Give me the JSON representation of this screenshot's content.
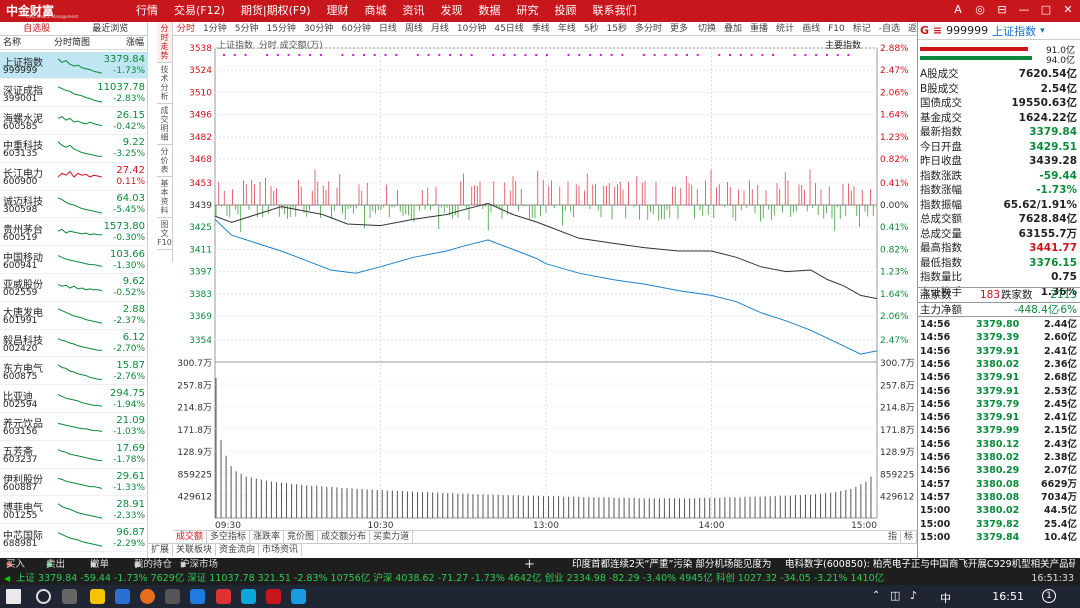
{
  "app": {
    "title": "中金财富",
    "subtitle": "CIRC Wealth Management"
  },
  "topmenu": [
    "行情",
    "交易(F12)",
    "期货|期权(F9)",
    "理财",
    "商城",
    "资讯",
    "发现",
    "数据",
    "研究",
    "投顾",
    "联系我们"
  ],
  "window_controls": [
    "A",
    "◎",
    "⊟",
    "—",
    "□",
    "✕"
  ],
  "left": {
    "tabs": [
      "自选股",
      "最近浏览"
    ],
    "headers": [
      "名称",
      "分时简图",
      "涨幅"
    ],
    "stocks": [
      {
        "name": "上证指数",
        "code": "999999",
        "price": "3379.84",
        "pct": "-1.73%",
        "dir": "down",
        "trend": [
          0.1,
          0.3,
          0.2,
          0.4,
          0.5,
          0.45,
          0.6,
          0.65,
          0.7,
          0.8,
          0.85,
          0.9
        ],
        "selected": true
      },
      {
        "name": "深证成指",
        "code": "399001",
        "price": "11037.78",
        "pct": "-2.83%",
        "dir": "down",
        "trend": [
          0.1,
          0.2,
          0.3,
          0.35,
          0.5,
          0.55,
          0.6,
          0.7,
          0.75,
          0.85,
          0.9,
          0.95
        ]
      },
      {
        "name": "海螺水泥",
        "code": "600585",
        "price": "26.15",
        "pct": "-0.42%",
        "dir": "down",
        "trend": [
          0.3,
          0.2,
          0.4,
          0.3,
          0.5,
          0.45,
          0.55,
          0.6,
          0.5,
          0.6,
          0.65,
          0.7
        ]
      },
      {
        "name": "中重科技",
        "code": "603135",
        "price": "9.22",
        "pct": "-3.25%",
        "dir": "down",
        "trend": [
          0.1,
          0.3,
          0.4,
          0.3,
          0.5,
          0.6,
          0.7,
          0.75,
          0.8,
          0.85,
          0.9,
          0.9
        ]
      },
      {
        "name": "长江电力",
        "code": "600900",
        "price": "27.42",
        "pct": "0.11%",
        "dir": "up",
        "trend": [
          0.5,
          0.3,
          0.4,
          0.2,
          0.5,
          0.3,
          0.4,
          0.35,
          0.5,
          0.4,
          0.45,
          0.5
        ]
      },
      {
        "name": "诚迈科技",
        "code": "300598",
        "price": "64.03",
        "pct": "-5.45%",
        "dir": "down",
        "trend": [
          0.1,
          0.2,
          0.35,
          0.45,
          0.5,
          0.6,
          0.7,
          0.75,
          0.8,
          0.85,
          0.9,
          0.95
        ]
      },
      {
        "name": "贵州茅台",
        "code": "600519",
        "price": "1573.80",
        "pct": "-0.30%",
        "dir": "down",
        "trend": [
          0.4,
          0.3,
          0.5,
          0.4,
          0.45,
          0.5,
          0.55,
          0.5,
          0.6,
          0.55,
          0.6,
          0.6
        ]
      },
      {
        "name": "中国移动",
        "code": "600941",
        "price": "103.66",
        "pct": "-1.30%",
        "dir": "down",
        "trend": [
          0.2,
          0.3,
          0.4,
          0.45,
          0.5,
          0.55,
          0.6,
          0.65,
          0.7,
          0.7,
          0.75,
          0.8
        ]
      },
      {
        "name": "亚威股份",
        "code": "002559",
        "price": "9.62",
        "pct": "-0.52%",
        "dir": "down",
        "trend": [
          0.3,
          0.4,
          0.35,
          0.5,
          0.4,
          0.55,
          0.5,
          0.6,
          0.55,
          0.6,
          0.6,
          0.65
        ]
      },
      {
        "name": "大唐发电",
        "code": "601991",
        "price": "2.88",
        "pct": "-2.37%",
        "dir": "down",
        "trend": [
          0.1,
          0.2,
          0.3,
          0.4,
          0.5,
          0.55,
          0.6,
          0.7,
          0.75,
          0.8,
          0.85,
          0.9
        ]
      },
      {
        "name": "毅昌科技",
        "code": "002420",
        "price": "6.12",
        "pct": "-2.70%",
        "dir": "down",
        "trend": [
          0.2,
          0.3,
          0.35,
          0.45,
          0.5,
          0.6,
          0.65,
          0.7,
          0.75,
          0.8,
          0.85,
          0.85
        ]
      },
      {
        "name": "东方电气",
        "code": "600875",
        "price": "15.87",
        "pct": "-2.76%",
        "dir": "down",
        "trend": [
          0.1,
          0.25,
          0.3,
          0.45,
          0.5,
          0.6,
          0.65,
          0.7,
          0.8,
          0.85,
          0.9,
          0.9
        ]
      },
      {
        "name": "比亚迪",
        "code": "002594",
        "price": "294.75",
        "pct": "-1.94%",
        "dir": "down",
        "trend": [
          0.2,
          0.3,
          0.4,
          0.45,
          0.5,
          0.55,
          0.65,
          0.7,
          0.75,
          0.8,
          0.8,
          0.85
        ]
      },
      {
        "name": "养元饮品",
        "code": "603156",
        "price": "21.09",
        "pct": "-1.03%",
        "dir": "down",
        "trend": [
          0.3,
          0.35,
          0.4,
          0.45,
          0.5,
          0.55,
          0.6,
          0.6,
          0.65,
          0.7,
          0.7,
          0.75
        ]
      },
      {
        "name": "五芳斋",
        "code": "603237",
        "price": "17.69",
        "pct": "-1.78%",
        "dir": "down",
        "trend": [
          0.2,
          0.3,
          0.35,
          0.45,
          0.5,
          0.55,
          0.6,
          0.65,
          0.7,
          0.75,
          0.8,
          0.8
        ]
      },
      {
        "name": "伊利股份",
        "code": "600887",
        "price": "29.61",
        "pct": "-1.33%",
        "dir": "down",
        "trend": [
          0.25,
          0.3,
          0.4,
          0.45,
          0.5,
          0.55,
          0.6,
          0.65,
          0.7,
          0.7,
          0.75,
          0.8
        ]
      },
      {
        "name": "博菲电气",
        "code": "001255",
        "price": "28.91",
        "pct": "-2.33%",
        "dir": "down",
        "trend": [
          0.1,
          0.25,
          0.35,
          0.4,
          0.5,
          0.6,
          0.65,
          0.7,
          0.75,
          0.8,
          0.85,
          0.9
        ]
      },
      {
        "name": "中芯国际",
        "code": "688981",
        "price": "96.87",
        "pct": "-2.29%",
        "dir": "down",
        "trend": [
          0.15,
          0.25,
          0.35,
          0.45,
          0.5,
          0.55,
          0.65,
          0.7,
          0.75,
          0.8,
          0.85,
          0.9
        ]
      }
    ]
  },
  "vtabs": [
    "分时走势",
    "技术分析",
    "成交明细",
    "分价表",
    "基本资料",
    "图文F10"
  ],
  "periods": [
    "分时",
    "1分钟",
    "5分钟",
    "15分钟",
    "30分钟",
    "60分钟",
    "日线",
    "周线",
    "月线",
    "10分钟",
    "45日线",
    "季线",
    "年线",
    "5秒",
    "15秒",
    "多分时",
    "更多"
  ],
  "toolbar2": [
    "切换",
    "叠加",
    "重播",
    "统计",
    "画线",
    "F10",
    "标记",
    "-自选",
    "返回"
  ],
  "chart_header": {
    "label": "上证指数",
    "mode": "分时",
    "volume_label": "成交额(万)",
    "main_index": "主要指数"
  },
  "chart_data": {
    "type": "line",
    "title": "",
    "prev_close": 3439.28,
    "ylim": [
      3340,
      3538
    ],
    "price_ticks": [
      3538,
      3524,
      3510,
      3496,
      3482,
      3468,
      3453,
      3439,
      3425,
      3411,
      3397,
      3383,
      3369,
      3354
    ],
    "pct_ticks_up": [
      "2.88%",
      "2.47%",
      "2.06%",
      "1.64%",
      "1.23%",
      "0.82%",
      "0.41%",
      "0.00%"
    ],
    "pct_ticks_down": [
      "0.41%",
      "0.82%",
      "1.23%",
      "1.64%",
      "2.06%",
      "2.47%",
      "2.88%"
    ],
    "volume_ticks_left": [
      "300.7万",
      "257.8万",
      "214.8万",
      "171.8万",
      "128.9万",
      "859225",
      "429612"
    ],
    "volume_ticks_right": [
      "300.7万",
      "257.8万",
      "214.8万",
      "171.8万",
      "128.9万",
      "859225",
      "429612"
    ],
    "x_ticks": [
      "09:30",
      "10:30",
      "13:00",
      "14:00",
      "15:00"
    ],
    "series": [
      {
        "name": "",
        "color": "#1a83c9",
        "x_hours": [
          9.5,
          9.6,
          9.75,
          9.9,
          10.0,
          10.1,
          10.2,
          10.35,
          10.5,
          10.7,
          10.9,
          11.0,
          11.15,
          11.3,
          11.45,
          13.0,
          13.2,
          13.4,
          13.6,
          13.8,
          14.0,
          14.15,
          14.3,
          14.45,
          14.6,
          14.7,
          14.8,
          14.9,
          15.0
        ],
        "values": [
          3430,
          3420,
          3415,
          3410,
          3406,
          3402,
          3398,
          3396,
          3400,
          3406,
          3410,
          3413,
          3417,
          3411,
          3405,
          3402,
          3396,
          3392,
          3389,
          3385,
          3382,
          3378,
          3371,
          3366,
          3360,
          3355,
          3350,
          3345,
          3347
        ]
      },
      {
        "name": "",
        "color": "#333333",
        "x_hours": [
          9.5,
          9.6,
          9.75,
          9.9,
          10.0,
          10.15,
          10.3,
          10.5,
          10.7,
          10.9,
          11.0,
          11.15,
          11.3,
          11.45,
          13.0,
          13.2,
          13.4,
          13.6,
          13.8,
          14.0,
          14.15,
          14.3,
          14.45,
          14.6,
          14.7,
          14.8,
          14.9,
          15.0
        ],
        "values": [
          3432,
          3428,
          3433,
          3438,
          3436,
          3433,
          3427,
          3426,
          3430,
          3433,
          3436,
          3440,
          3433,
          3428,
          3426,
          3418,
          3415,
          3412,
          3410,
          3410,
          3406,
          3400,
          3397,
          3398,
          3392,
          3388,
          3382,
          3380
        ]
      }
    ],
    "volume_max": 3007000,
    "volume": [
      2700,
      1500,
      1200,
      1000,
      900,
      850,
      800,
      780,
      760,
      740,
      720,
      700,
      690,
      680,
      670,
      660,
      650,
      640,
      630,
      620,
      620,
      610,
      600,
      600,
      590,
      580,
      580,
      570,
      560,
      560,
      550,
      550,
      540,
      540,
      530,
      530,
      520,
      520,
      510,
      510,
      500,
      500,
      500,
      490,
      490,
      480,
      480,
      480,
      470,
      470,
      470,
      460,
      460,
      460,
      450,
      450,
      450,
      440,
      440,
      440,
      440,
      430,
      430,
      430,
      430,
      420,
      420,
      420,
      420,
      410,
      410,
      410,
      410,
      400,
      400,
      400,
      400,
      400,
      400,
      390,
      390,
      390,
      390,
      390,
      380,
      380,
      380,
      380,
      380,
      380,
      380,
      380,
      380,
      380,
      380,
      380,
      390,
      390,
      390,
      390,
      390,
      400,
      400,
      400,
      400,
      410,
      410,
      410,
      410,
      420,
      420,
      420,
      430,
      430,
      430,
      440,
      440,
      450,
      450,
      460,
      470,
      480,
      490,
      500,
      520,
      540,
      560,
      600,
      650,
      700,
      800
    ]
  },
  "bottom_tabs": [
    "成交额",
    "多空指标",
    "涨跌率",
    "竞价图",
    "成交额分布",
    "买卖力道"
  ],
  "bottom_tabs_right": [
    "指",
    "标"
  ],
  "bottom_tabs2": [
    "扩展",
    "关联板块",
    "资金流向",
    "市场资讯"
  ],
  "right": {
    "code": "999999",
    "name": "上证指数",
    "prefix": "G ≡",
    "bar1": "91.0亿",
    "bar2": "94.0亿",
    "stats": [
      {
        "k": "A股成交",
        "v": "7620.54亿",
        "c": "#222"
      },
      {
        "k": "B股成交",
        "v": "2.54亿",
        "c": "#222"
      },
      {
        "k": "国债成交",
        "v": "19550.63亿",
        "c": "#222"
      },
      {
        "k": "基金成交",
        "v": "1624.22亿",
        "c": "#222"
      },
      {
        "k": "最新指数",
        "v": "3379.84",
        "c": "#0a8a3a"
      },
      {
        "k": "今日开盘",
        "v": "3429.51",
        "c": "#0a8a3a"
      },
      {
        "k": "昨日收盘",
        "v": "3439.28",
        "c": "#222"
      },
      {
        "k": "指数涨跌",
        "v": "-59.44",
        "c": "#0a8a3a"
      },
      {
        "k": "指数涨幅",
        "v": "-1.73%",
        "c": "#0a8a3a"
      },
      {
        "k": "指数振幅",
        "v": "65.62/1.91%",
        "c": "#222"
      },
      {
        "k": "总成交额",
        "v": "7628.84亿",
        "c": "#222"
      },
      {
        "k": "总成交量",
        "v": "63155.7万",
        "c": "#222"
      },
      {
        "k": "最高指数",
        "v": "3441.77",
        "c": "#d0121b"
      },
      {
        "k": "最低指数",
        "v": "3376.15",
        "c": "#0a8a3a"
      },
      {
        "k": "指数量比",
        "v": "0.75",
        "c": "#222"
      },
      {
        "k": "上证换手",
        "v": "1.36%",
        "c": "#222"
      }
    ],
    "updown": {
      "up_label": "涨家数",
      "up_value": "183",
      "down_label": "跌家数",
      "down_value": "2113"
    },
    "netflow": {
      "label": "主力净额",
      "value": "-448.4亿",
      "pct": "-6%"
    },
    "ticks": [
      {
        "t": "14:56",
        "p": "3379.80",
        "q": "2.44亿"
      },
      {
        "t": "14:56",
        "p": "3379.39",
        "q": "2.60亿"
      },
      {
        "t": "14:56",
        "p": "3379.91",
        "q": "2.41亿"
      },
      {
        "t": "14:56",
        "p": "3380.02",
        "q": "2.36亿"
      },
      {
        "t": "14:56",
        "p": "3379.91",
        "q": "2.68亿"
      },
      {
        "t": "14:56",
        "p": "3379.91",
        "q": "2.53亿"
      },
      {
        "t": "14:56",
        "p": "3379.79",
        "q": "2.45亿"
      },
      {
        "t": "14:56",
        "p": "3379.91",
        "q": "2.41亿"
      },
      {
        "t": "14:56",
        "p": "3379.99",
        "q": "2.15亿"
      },
      {
        "t": "14:56",
        "p": "3380.12",
        "q": "2.43亿"
      },
      {
        "t": "14:56",
        "p": "3380.02",
        "q": "2.38亿"
      },
      {
        "t": "14:56",
        "p": "3380.29",
        "q": "2.07亿"
      },
      {
        "t": "14:57",
        "p": "3380.08",
        "q": "6629万"
      },
      {
        "t": "14:57",
        "p": "3380.08",
        "q": "7034万"
      },
      {
        "t": "15:00",
        "p": "3380.02",
        "q": "44.5亿"
      },
      {
        "t": "15:00",
        "p": "3379.82",
        "q": "25.4亿"
      },
      {
        "t": "15:00",
        "p": "3379.84",
        "q": "10.4亿"
      }
    ]
  },
  "tradebar": {
    "buy": "买入",
    "sell": "卖出",
    "cancel": "撤单",
    "holdings": "我的持仓",
    "market": "沪深市场",
    "news": "印度首都连续2天“严重”污染 部分机场能见度为“零”",
    "news2": "电科数字(600850): 柏壳电子正与中国商飞开展C929机型相关产品研制",
    "plus": "+"
  },
  "status": "上证 3379.84 -59.44 -1.73% 7629亿 深证 11037.78 321.51 -2.83% 10756亿 沪深 4038.62 -71.27 -1.73% 4642亿 创业 2334.98 -82.29 -3.40% 4945亿 科创 1027.32 -34.05 -3.21% 1410亿",
  "status_time": "16:51:33",
  "taskbar": {
    "time": "16:51",
    "ime": "中",
    "notif": "1"
  }
}
